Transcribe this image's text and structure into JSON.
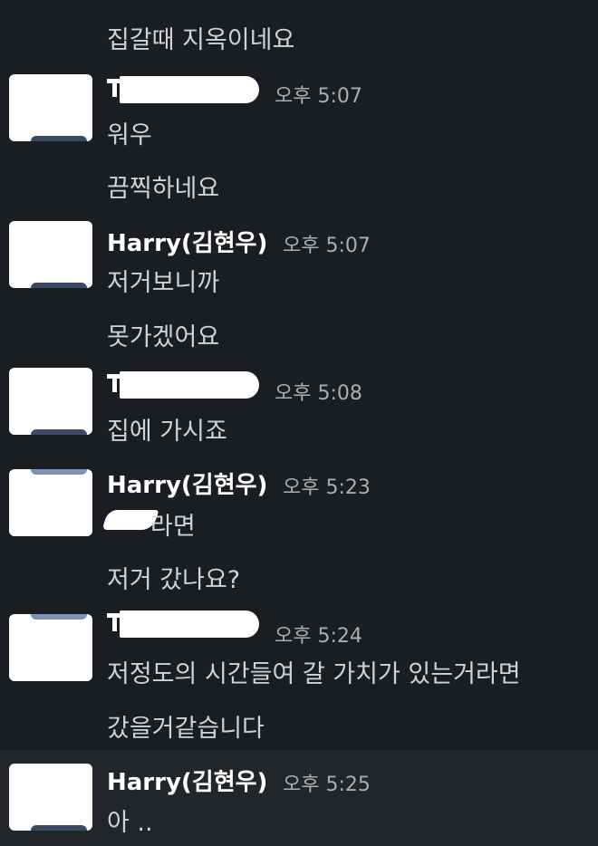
{
  "messages": [
    {
      "text": "집갈때 지옥이네요"
    },
    {
      "author": "",
      "author_redacted": true,
      "time": "오후 5:07",
      "lines": [
        "워우",
        "끔찍하네요"
      ]
    },
    {
      "author": "Harry(김현우)",
      "time": "오후 5:07",
      "lines": [
        "저거보니까",
        "못가겠어요"
      ]
    },
    {
      "author": "",
      "author_redacted": true,
      "time": "오후 5:08",
      "lines": [
        "집에 가시죠"
      ]
    },
    {
      "author": "Harry(김현우)",
      "time": "오후 5:23",
      "lines": [
        "라면",
        "저거 갔나요?"
      ]
    },
    {
      "author": "",
      "author_redacted": true,
      "time": "오후 5:24",
      "lines": [
        "저정도의 시간들여 갈 가치가 있는거라면",
        "갔을거같습니다"
      ]
    },
    {
      "author": "Harry(김현우)",
      "time": "오후 5:25",
      "lines": [
        "아 .."
      ],
      "highlighted": true
    }
  ],
  "colors": {
    "background": "#1a1d21",
    "highlight_row": "#222529",
    "author_text": "#ffffff",
    "message_text": "#d1d2d3",
    "timestamp_text": "#abadb0"
  },
  "icons": [
    "redacted-avatar-image"
  ]
}
